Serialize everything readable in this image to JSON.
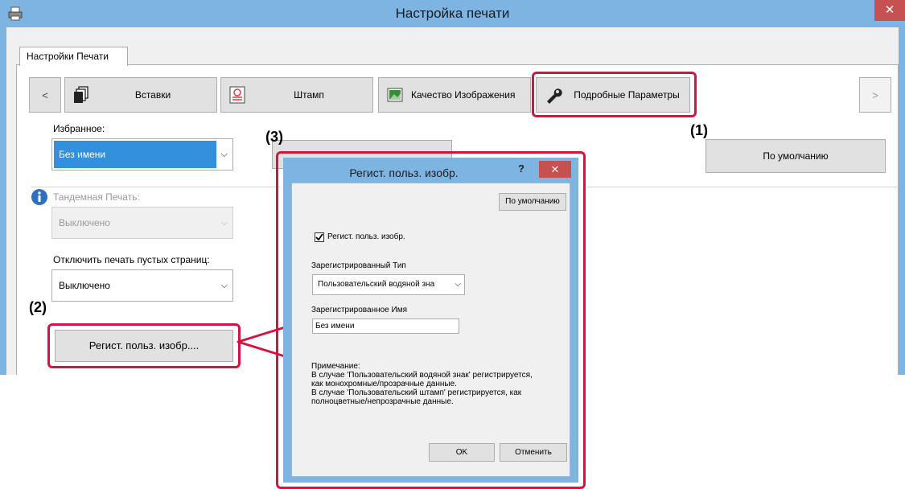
{
  "window": {
    "title": "Настройка печати",
    "close_glyph": "✕",
    "tab": "Настройки Печати"
  },
  "nav": {
    "prev_glyph": "<",
    "next_glyph": ">",
    "items": [
      {
        "label": "Вставки",
        "icon": "inserts-icon"
      },
      {
        "label": "Штамп",
        "icon": "stamp-icon"
      },
      {
        "label": "Качество Изображения",
        "icon": "image-quality-icon"
      },
      {
        "label": "Подробные Параметры",
        "icon": "wrench-icon"
      }
    ]
  },
  "form": {
    "favorites_label": "Избранное:",
    "favorites_value": "Без имени",
    "defaults_button": "По умолчанию",
    "tandem_label": "Тандемная Печать:",
    "tandem_value": "Выключено",
    "blank_pages_label": "Отключить печать пустых страниц:",
    "blank_pages_value": "Выключено",
    "register_image_button": "Регист. польз. изобр...."
  },
  "markers": {
    "m1": "(1)",
    "m2": "(2)",
    "m3": "(3)"
  },
  "dialog": {
    "title": "Регист. польз. изобр.",
    "help_glyph": "?",
    "close_glyph": "✕",
    "defaults_button": "По умолчанию",
    "checkbox_label": "Регист. польз. изобр.",
    "checkbox_checked": true,
    "type_label": "Зарегистрированный Тип",
    "type_value": "Пользовательский водяной зна",
    "name_label": "Зарегистрированное Имя",
    "name_value": "Без имени",
    "note_lines": [
      "Примечание:",
      "В случае 'Пользовательский водяной знак' регистрируется,",
      "как монохромные/прозрачные данные.",
      "В случае 'Пользовательский штамп' регистрируется, как",
      "полноцветные/непрозрачные данные."
    ],
    "ok_button": "OK",
    "cancel_button": "Отменить"
  },
  "colors": {
    "titlebar": "#7eb4e2",
    "highlight": "#d8123f",
    "selection": "#3390dd",
    "close": "#c75050"
  }
}
